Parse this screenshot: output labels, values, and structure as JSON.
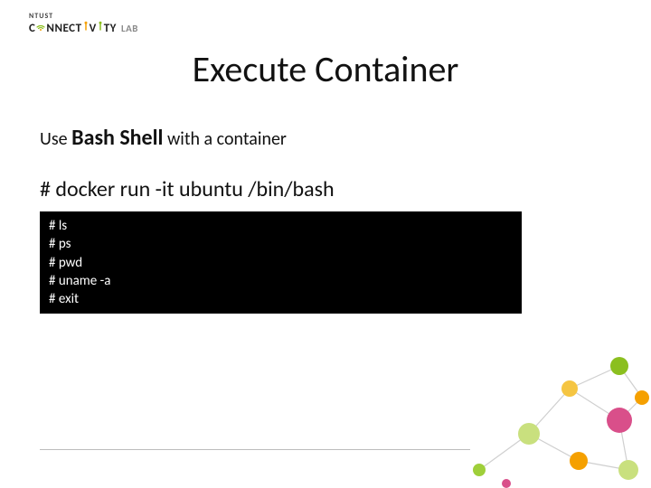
{
  "logo": {
    "ntust": "NTUST",
    "pre": "C",
    "mid1": "NNECT",
    "mid2": "V",
    "post": "TY",
    "lab": "LAB"
  },
  "title": "Execute Container",
  "subline": {
    "use": "Use ",
    "bold": "Bash Shell",
    "rest": " with a container"
  },
  "command": "# docker run -it ubuntu /bin/bash",
  "terminal": [
    "# ls",
    "# ps",
    "# pwd",
    "# uname  -a",
    "# exit"
  ]
}
